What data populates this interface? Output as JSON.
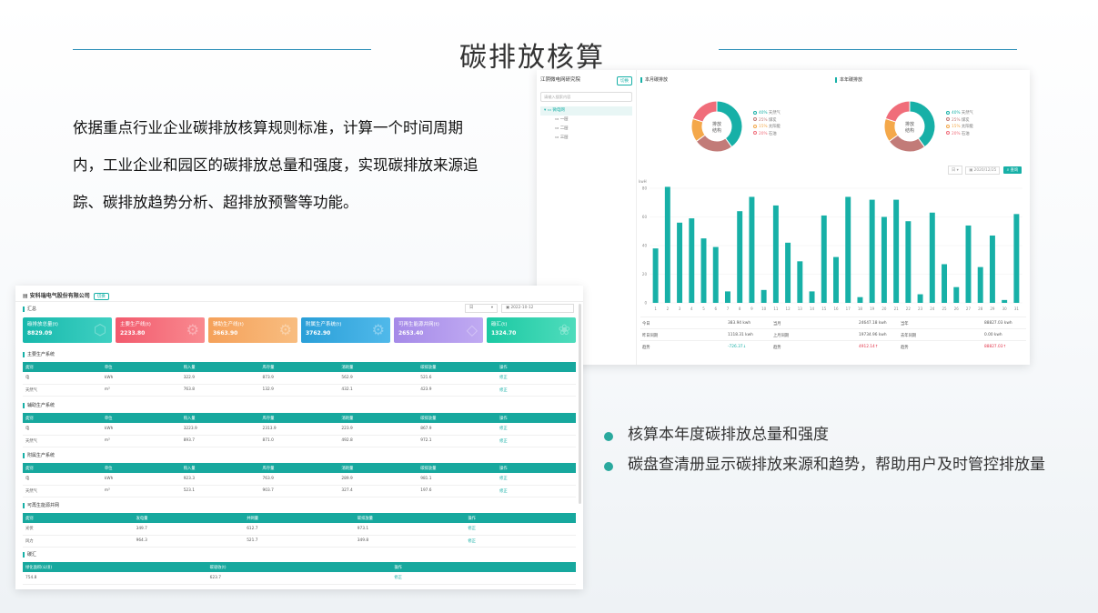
{
  "slide": {
    "title": "碳排放核算",
    "description": "依据重点行业企业碳排放核算规则标准，计算一个时间周期内，工业企业和园区的碳排放总量和强度，实现碳排放来源追踪、碳排放趋势分析、超排放预警等功能。",
    "bullets": [
      "核算本年度碳排放总量和强度",
      "碳盘查清册显示碳排放来源和趋势，帮助用户及时管控排放量"
    ],
    "accent": "#2aa99e"
  },
  "right_panel": {
    "org_name": "江阴微电网研究院",
    "switch_label": "切换",
    "search_placeholder": "请输入搜索内容",
    "tree": [
      {
        "label": "微电网",
        "selected": true
      },
      {
        "label": "一层",
        "selected": false
      },
      {
        "label": "二层",
        "selected": false
      },
      {
        "label": "三层",
        "selected": false
      }
    ],
    "month_section": "本月碳排放",
    "year_section": "本年碳排放",
    "donut_center": [
      "排放",
      "结构"
    ],
    "legend": [
      {
        "pct": "40%",
        "name": "天然气",
        "color": "#17b0a7"
      },
      {
        "pct": "25%",
        "name": "煤炭",
        "color": "#c27b78"
      },
      {
        "pct": "15%",
        "name": "太阳能",
        "color": "#f4a84a"
      },
      {
        "pct": "20%",
        "name": "石油",
        "color": "#f06d7a"
      }
    ],
    "toolbar": {
      "unit": "日",
      "date": "2020/12/25",
      "query": "查询"
    },
    "y_unit": "kwH",
    "stats": [
      [
        "今日",
        "383.94 kwh",
        "当月",
        "24647.18 kwh",
        "当年",
        "88827.03 kwh"
      ],
      [
        "昨日同期",
        "1118.31 kwh",
        "上月同期",
        "19734.96 kwh",
        "去年同期",
        "0.00 kwh"
      ],
      [
        "趋势",
        "-726.37↓",
        "趋势",
        "4912.14↑",
        "趋势",
        "88827.03↑"
      ]
    ],
    "chart_data": {
      "type": "bar",
      "categories": [
        "1",
        "2",
        "3",
        "4",
        "5",
        "6",
        "7",
        "8",
        "9",
        "10",
        "11",
        "12",
        "13",
        "14",
        "15",
        "16",
        "17",
        "18",
        "19",
        "20",
        "21",
        "22",
        "23",
        "24",
        "25",
        "26",
        "27",
        "28",
        "29",
        "30",
        "31"
      ],
      "values": [
        38,
        81,
        56,
        59,
        45,
        39,
        8,
        64,
        74,
        9,
        68,
        42,
        29,
        8,
        61,
        32,
        74,
        4,
        72,
        60,
        72,
        57,
        6,
        63,
        27,
        11,
        54,
        25,
        47,
        2,
        62
      ],
      "ylabel": "kwH",
      "ylim": [
        0,
        80
      ],
      "yticks": [
        0,
        20,
        40,
        60,
        80
      ],
      "color": "#17b0a7"
    }
  },
  "left_panel": {
    "company": "安科瑞电气股份有限公司",
    "switch_label": "切换",
    "summary_title": "汇总",
    "unit": "日",
    "date": "2022-10-12",
    "cards": [
      {
        "label": "碳排放总量(t)",
        "value": "8829.09",
        "color": "#17b8ac"
      },
      {
        "label": "主要生产线(t)",
        "value": "2233.80",
        "color": "#f25a6d"
      },
      {
        "label": "辅助生产线(t)",
        "value": "3663.90",
        "color": "#f5a15a"
      },
      {
        "label": "附属生产系统(t)",
        "value": "3762.90",
        "color": "#2a9fd8"
      },
      {
        "label": "可再生能源并网(t)",
        "value": "2653.40",
        "color": "#a58ae8"
      },
      {
        "label": "碳汇(t)",
        "value": "1324.70",
        "color": "#1bc9a3"
      }
    ],
    "sections": [
      {
        "title": "主要生产系统",
        "headers": [
          "类别",
          "单位",
          "购入量",
          "库存量",
          "消耗量",
          "碳排放量",
          "操作"
        ],
        "rows": [
          [
            "电",
            "kWh",
            "322.9",
            "873.9",
            "562.9",
            "521.6",
            "修正"
          ],
          [
            "天然气",
            "m³",
            "763.8",
            "132.9",
            "432.1",
            "423.9",
            "修正"
          ]
        ]
      },
      {
        "title": "辅助生产系统",
        "headers": [
          "类别",
          "单位",
          "购入量",
          "库存量",
          "消耗量",
          "碳排放量",
          "操作"
        ],
        "rows": [
          [
            "电",
            "kWh",
            "3223.9",
            "2313.9",
            "223.9",
            "867.9",
            "修正"
          ],
          [
            "天然气",
            "m³",
            "893.7",
            "871.0",
            "492.8",
            "972.1",
            "修正"
          ]
        ]
      },
      {
        "title": "附属生产系统",
        "headers": [
          "类别",
          "单位",
          "购入量",
          "库存量",
          "消耗量",
          "碳排放量",
          "操作"
        ],
        "rows": [
          [
            "电",
            "kWh",
            "923.3",
            "763.9",
            "289.9",
            "981.1",
            "修正"
          ],
          [
            "天然气",
            "m³",
            "523.1",
            "903.7",
            "327.4",
            "197.6",
            "修正"
          ]
        ]
      },
      {
        "title": "可再生能源并网",
        "headers": [
          "类别",
          "发电量",
          "并网量",
          "碳排放量",
          "操作"
        ],
        "rows": [
          [
            "光伏",
            "349.7",
            "612.7",
            "973.1",
            "修正"
          ],
          [
            "风力",
            "964.3",
            "521.7",
            "349.8",
            "修正"
          ]
        ]
      },
      {
        "title": "碳汇",
        "headers": [
          "绿化面积(公顷)",
          "碳吸收(t)",
          "操作"
        ],
        "rows": [
          [
            "754.8",
            "623.7",
            "修正"
          ]
        ]
      }
    ]
  }
}
